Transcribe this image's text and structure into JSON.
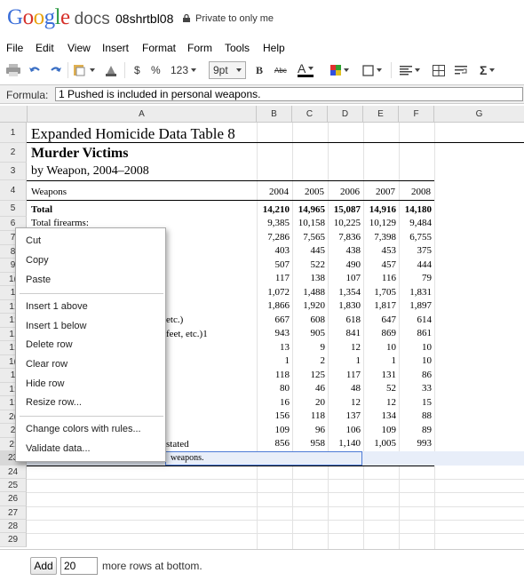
{
  "app": {
    "logo": {
      "letters": [
        "G",
        "o",
        "o",
        "g",
        "l",
        "e"
      ],
      "product": "docs"
    },
    "document_title": "08shrtbl08",
    "privacy": "Private to only me"
  },
  "menu": [
    "File",
    "Edit",
    "View",
    "Insert",
    "Format",
    "Form",
    "Tools",
    "Help"
  ],
  "toolbar": {
    "currency": "$",
    "percent": "%",
    "number_format": "123",
    "font_size": "9pt",
    "bold": "B",
    "strike": "Abc",
    "text_color": "A",
    "sum": "Σ"
  },
  "formula": {
    "label": "Formula:",
    "value": "1 Pushed is included in personal weapons."
  },
  "columns": [
    "A",
    "B",
    "C",
    "D",
    "E",
    "F",
    "G"
  ],
  "rows": [
    "1",
    "2",
    "3",
    "4",
    "5",
    "6",
    "7",
    "8",
    "9",
    "10",
    "11",
    "12",
    "13",
    "14",
    "15",
    "16",
    "17",
    "18",
    "19",
    "20",
    "21",
    "22",
    "23",
    "24",
    "25",
    "26",
    "27",
    "28",
    "29"
  ],
  "row_labels_partial": {
    "7": "7",
    "8": "8",
    "9": "9",
    "10": "1(",
    "11": "1",
    "12": "1:",
    "13": "1:",
    "14": "1.",
    "15": "1:",
    "16": "1(",
    "17": "1",
    "18": "1:",
    "19": "1:",
    "20": "2(",
    "21": "2",
    "22": "2:",
    "23": "23"
  },
  "sheet": {
    "title": "Expanded Homicide Data Table 8",
    "subtitle": "Murder Victims",
    "subtitle2": "by Weapon, 2004–2008",
    "header_label": "Weapons",
    "years": [
      "2004",
      "2005",
      "2006",
      "2007",
      "2008"
    ],
    "total_label": "Total",
    "total_values": [
      "14,210",
      "14,965",
      "15,087",
      "14,916",
      "14,180"
    ],
    "firearms_label": "Total firearms:",
    "firearms_values": [
      "9,385",
      "10,158",
      "10,225",
      "10,129",
      "9,484"
    ],
    "data_rows": [
      [
        "7,286",
        "7,565",
        "7,836",
        "7,398",
        "6,755"
      ],
      [
        "403",
        "445",
        "438",
        "453",
        "375"
      ],
      [
        "507",
        "522",
        "490",
        "457",
        "444"
      ],
      [
        "117",
        "138",
        "107",
        "116",
        "79"
      ],
      [
        "1,072",
        "1,488",
        "1,354",
        "1,705",
        "1,831"
      ],
      [
        "1,866",
        "1,920",
        "1,830",
        "1,817",
        "1,897"
      ],
      [
        "667",
        "608",
        "618",
        "647",
        "614"
      ],
      [
        "943",
        "905",
        "841",
        "869",
        "861"
      ],
      [
        "13",
        "9",
        "12",
        "10",
        "10"
      ],
      [
        "1",
        "2",
        "1",
        "1",
        "10"
      ],
      [
        "118",
        "125",
        "117",
        "131",
        "86"
      ],
      [
        "80",
        "46",
        "48",
        "52",
        "33"
      ],
      [
        "16",
        "20",
        "12",
        "12",
        "15"
      ],
      [
        "156",
        "118",
        "137",
        "134",
        "88"
      ],
      [
        "109",
        "96",
        "106",
        "109",
        "89"
      ],
      [
        "856",
        "958",
        "1,140",
        "1,005",
        "993"
      ]
    ],
    "partial_label_13": "etc.)",
    "partial_label_14": "feet, etc.)1",
    "partial_label_22": "stated",
    "footnote_partial": "weapons."
  },
  "context_menu": {
    "cut": "Cut",
    "copy": "Copy",
    "paste": "Paste",
    "insert_above": "Insert 1 above",
    "insert_below": "Insert 1 below",
    "delete_row": "Delete row",
    "clear_row": "Clear row",
    "hide_row": "Hide row",
    "resize_row": "Resize row...",
    "change_colors": "Change colors with rules...",
    "validate": "Validate data..."
  },
  "bottom": {
    "add_label": "Add",
    "rows_value": "20",
    "more_rows": "more rows at bottom."
  }
}
